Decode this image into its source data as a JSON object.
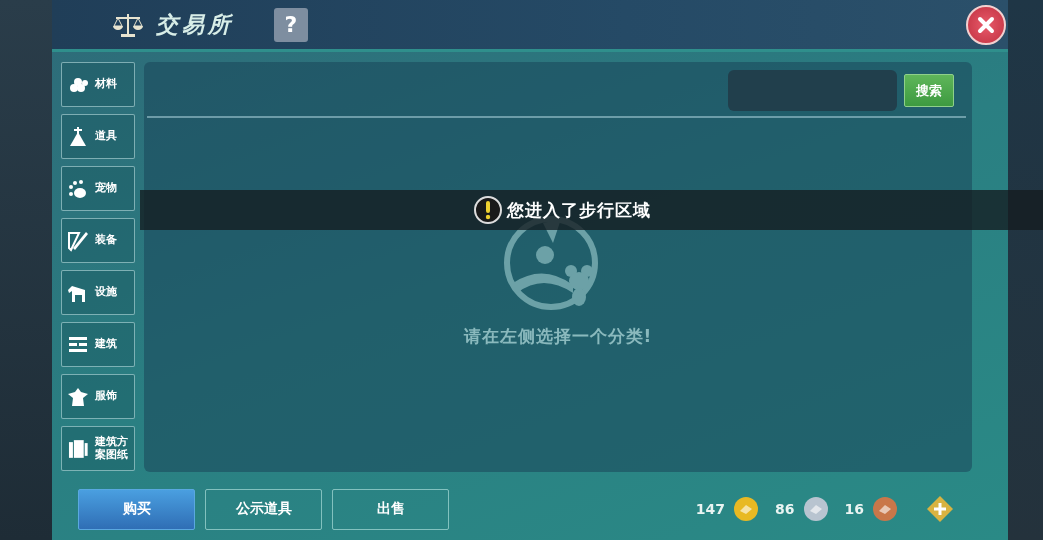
{
  "window": {
    "title": "交易所",
    "help_label": "?"
  },
  "categories": [
    {
      "label": "材料",
      "selected": false
    },
    {
      "label": "道具",
      "selected": false
    },
    {
      "label": "宠物",
      "selected": false
    },
    {
      "label": "装备",
      "selected": false
    },
    {
      "label": "设施",
      "selected": false
    },
    {
      "label": "建筑",
      "selected": false
    },
    {
      "label": "服饰",
      "selected": false
    },
    {
      "label": "建筑方案图纸",
      "selected": false
    }
  ],
  "search": {
    "button": "搜索"
  },
  "empty_message": "请在左侧选择一个分类!",
  "toast": {
    "text": "您进入了步行区域"
  },
  "tabs": [
    {
      "label": "购买",
      "selected": true
    },
    {
      "label": "公示道具",
      "selected": false
    },
    {
      "label": "出售",
      "selected": false
    }
  ],
  "currencies": [
    {
      "amount": "147",
      "color": "#e8b923"
    },
    {
      "amount": "86",
      "color": "#b8c4d0"
    },
    {
      "amount": "16",
      "color": "#c9774a"
    }
  ]
}
